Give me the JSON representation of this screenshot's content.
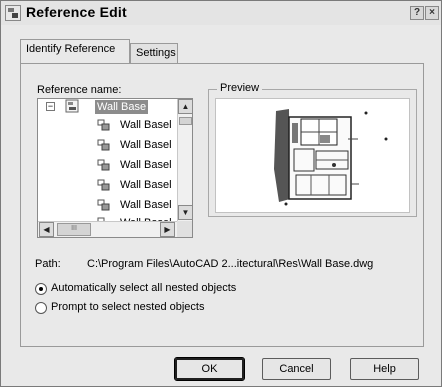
{
  "window": {
    "title": "Reference Edit",
    "help_glyph": "?",
    "close_glyph": "×"
  },
  "tabs": [
    {
      "label": "Identify Reference",
      "active": true
    },
    {
      "label": "Settings",
      "active": false
    }
  ],
  "reference": {
    "label": "Reference name:",
    "tree": {
      "root": {
        "label": "Wall Base",
        "expander": "−",
        "selected": true
      },
      "children": [
        "Wall Basel",
        "Wall Basel",
        "Wall Basel",
        "Wall Basel",
        "Wall Basel",
        "Wall Basel"
      ]
    },
    "scroll_up": "▲",
    "scroll_down": "▼",
    "scroll_left": "◀",
    "scroll_right": "▶",
    "hthumb_grip": "III"
  },
  "preview": {
    "legend": "Preview"
  },
  "path": {
    "label": "Path:",
    "value": "C:\\Program Files\\AutoCAD 2...itectural\\Res\\Wall Base.dwg"
  },
  "options": [
    {
      "label": "Automatically select all nested objects",
      "selected": true
    },
    {
      "label": "Prompt to select nested objects",
      "selected": false
    }
  ],
  "buttons": {
    "ok": "OK",
    "cancel": "Cancel",
    "help": "Help"
  },
  "colors": {
    "dialog_bg": "#e9e9e9",
    "selection": "#8c8c8c"
  }
}
